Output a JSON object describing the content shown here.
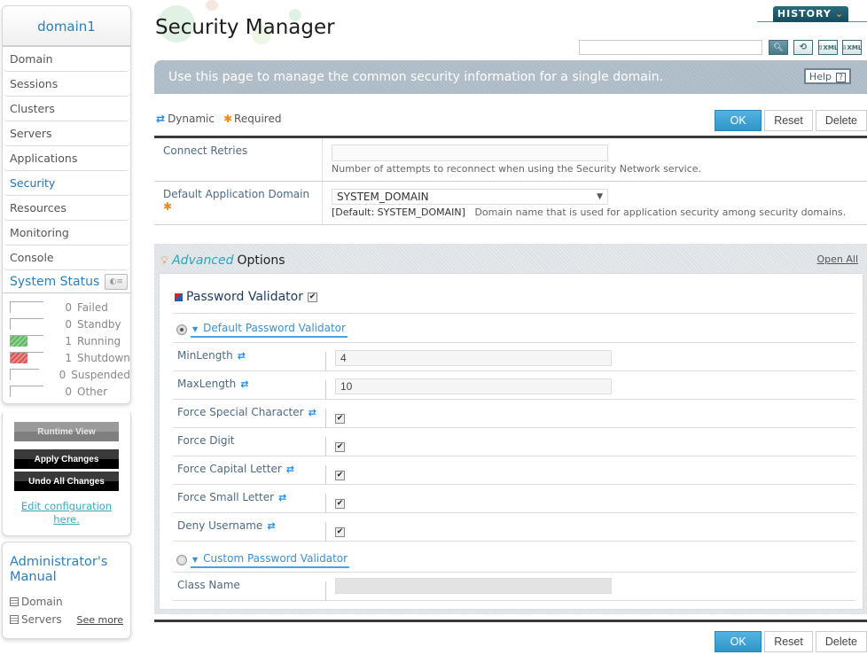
{
  "sidebar": {
    "domain": "domain1",
    "nav": [
      {
        "label": "Domain",
        "active": false
      },
      {
        "label": "Sessions",
        "active": false
      },
      {
        "label": "Clusters",
        "active": false
      },
      {
        "label": "Servers",
        "active": false
      },
      {
        "label": "Applications",
        "active": false
      },
      {
        "label": "Security",
        "active": true
      },
      {
        "label": "Resources",
        "active": false
      },
      {
        "label": "Monitoring",
        "active": false
      },
      {
        "label": "Console",
        "active": false
      }
    ],
    "system_status": {
      "title": "System Status",
      "items": [
        {
          "count": "0",
          "label": "Failed",
          "fill": 0,
          "color": ""
        },
        {
          "count": "0",
          "label": "Standby",
          "fill": 0,
          "color": ""
        },
        {
          "count": "1",
          "label": "Running",
          "fill": 0.5,
          "color": "#5cb85c"
        },
        {
          "count": "1",
          "label": "Shutdown",
          "fill": 0.5,
          "color": "#d9534f"
        },
        {
          "count": "0",
          "label": "Suspended",
          "fill": 0,
          "color": ""
        },
        {
          "count": "0",
          "label": "Other",
          "fill": 0,
          "color": ""
        }
      ]
    },
    "runtime_view": "Runtime View",
    "apply_changes": "Apply Changes",
    "undo_all_changes": "Undo All Changes",
    "edit_config_line1": "Edit configuration",
    "edit_config_line2": "here.",
    "manual": {
      "title": "Administrator's Manual",
      "links": [
        "Domain",
        "Servers"
      ],
      "see_more": "See more"
    }
  },
  "header": {
    "title": "Security Manager",
    "history": "HISTORY",
    "search_value": "",
    "tools": [
      "search-icon",
      "refresh-icon",
      "xml-upload-icon",
      "xml-download-icon"
    ]
  },
  "banner": {
    "text": "Use this page to manage the common security information for a single domain.",
    "help": "Help",
    "help_icon": "?"
  },
  "legend": {
    "dynamic": "Dynamic",
    "required": "Required"
  },
  "buttons": {
    "ok": "OK",
    "reset": "Reset",
    "delete": "Delete"
  },
  "form": {
    "connect_retries": {
      "label": "Connect Retries",
      "value": "",
      "desc": "Number of attempts to reconnect when using the Security Network service."
    },
    "default_app_domain": {
      "label": "Default Application Domain",
      "value": "SYSTEM_DOMAIN",
      "default": "[Default: SYSTEM_DOMAIN]",
      "desc": "Domain name that is used for application security among security domains."
    }
  },
  "advanced": {
    "title_em": "Advanced",
    "title_rest": "Options",
    "open_all": "Open All",
    "password_validator": {
      "title": "Password Validator",
      "enabled": true,
      "default_validator": {
        "label": "Default Password Validator",
        "selected": true,
        "fields": [
          {
            "label": "MinLength",
            "dynamic": true,
            "type": "text",
            "value": "4"
          },
          {
            "label": "MaxLength",
            "dynamic": true,
            "type": "text",
            "value": "10"
          },
          {
            "label": "Force Special Character",
            "dynamic": true,
            "type": "checkbox",
            "checked": true
          },
          {
            "label": "Force Digit",
            "dynamic": false,
            "type": "checkbox",
            "checked": true
          },
          {
            "label": "Force Capital Letter",
            "dynamic": true,
            "type": "checkbox",
            "checked": true
          },
          {
            "label": "Force Small Letter",
            "dynamic": true,
            "type": "checkbox",
            "checked": true
          },
          {
            "label": "Deny Username",
            "dynamic": true,
            "type": "checkbox",
            "checked": true
          }
        ]
      },
      "custom_validator": {
        "label": "Custom Password Validator",
        "selected": false,
        "class_name_label": "Class Name",
        "class_name_value": ""
      }
    }
  }
}
